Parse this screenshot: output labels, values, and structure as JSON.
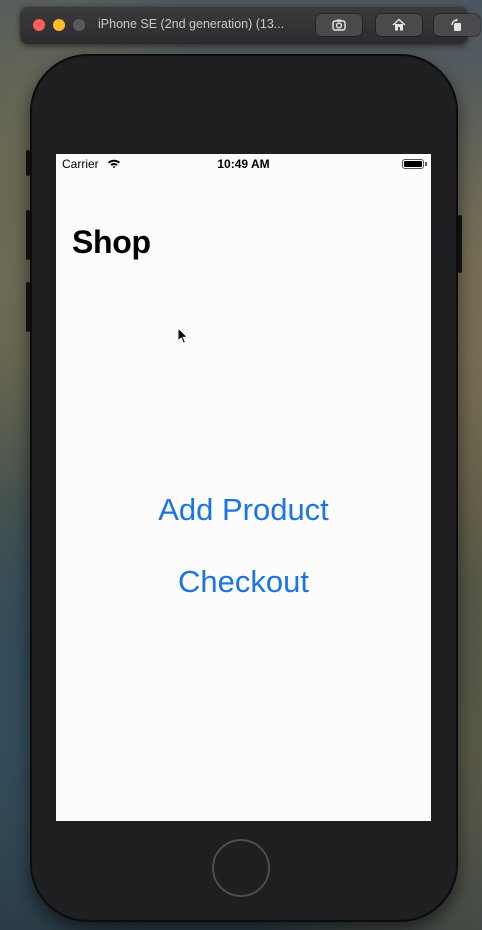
{
  "window": {
    "title": "iPhone SE (2nd generation) (13..."
  },
  "toolbar": {
    "screenshot_icon": "camera-icon",
    "home_icon": "home-icon",
    "rotate_icon": "rotate-icon"
  },
  "status_bar": {
    "carrier": "Carrier",
    "time": "10:49 AM",
    "battery_level": 1.0
  },
  "nav": {
    "title": "Shop"
  },
  "main": {
    "add_product_label": "Add Product",
    "checkout_label": "Checkout"
  },
  "colors": {
    "accent": "#1a74e8",
    "screen_background": "#fcfcfc",
    "device_body": "#1f1f21"
  }
}
